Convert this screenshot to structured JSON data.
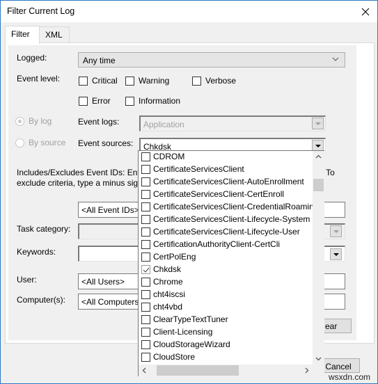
{
  "window": {
    "title": "Filter Current Log",
    "close_icon": "close-icon"
  },
  "tabs": [
    {
      "label": "Filter",
      "active": true
    },
    {
      "label": "XML",
      "active": false
    }
  ],
  "filter": {
    "logged": {
      "label": "Logged:",
      "value": "Any time"
    },
    "event_level": {
      "label": "Event level:",
      "options": [
        {
          "label": "Critical",
          "checked": false
        },
        {
          "label": "Warning",
          "checked": false
        },
        {
          "label": "Verbose",
          "checked": false
        },
        {
          "label": "Error",
          "checked": false
        },
        {
          "label": "Information",
          "checked": false
        }
      ]
    },
    "by_log": {
      "label": "By log",
      "selected": true,
      "enabled": false
    },
    "by_source": {
      "label": "By source",
      "selected": false,
      "enabled": false
    },
    "event_logs": {
      "label": "Event logs:",
      "value": "Application",
      "enabled": false
    },
    "event_sources": {
      "label": "Event sources:",
      "value": "Chkdsk"
    },
    "event_ids_text_line1": "Includes/Excludes Event IDs: Ente",
    "event_ids_text_line1_tail": "as. To",
    "event_ids_text_line2": "exclude criteria, type a minus sign",
    "event_ids": {
      "value": "<All Event IDs>"
    },
    "task_category": {
      "label": "Task category:",
      "value": ""
    },
    "keywords": {
      "label": "Keywords:",
      "value": ""
    },
    "user": {
      "label": "User:",
      "value": "<All Users>"
    },
    "computers": {
      "label": "Computer(s):",
      "value": "<All Computers"
    },
    "clear_button": "ear"
  },
  "sources_dropdown": {
    "items": [
      {
        "label": "CDROM",
        "checked": false
      },
      {
        "label": "CertificateServicesClient",
        "checked": false
      },
      {
        "label": "CertificateServicesClient-AutoEnrollment",
        "checked": false
      },
      {
        "label": "CertificateServicesClient-CertEnroll",
        "checked": false
      },
      {
        "label": "CertificateServicesClient-CredentialRoamin",
        "checked": false
      },
      {
        "label": "CertificateServicesClient-Lifecycle-System",
        "checked": false
      },
      {
        "label": "CertificateServicesClient-Lifecycle-User",
        "checked": false
      },
      {
        "label": "CertificationAuthorityClient-CertCli",
        "checked": false
      },
      {
        "label": "CertPolEng",
        "checked": false
      },
      {
        "label": "Chkdsk",
        "checked": true
      },
      {
        "label": "Chrome",
        "checked": false
      },
      {
        "label": "cht4iscsi",
        "checked": false
      },
      {
        "label": "cht4vbd",
        "checked": false
      },
      {
        "label": "ClearTypeTextTuner",
        "checked": false
      },
      {
        "label": "Client-Licensing",
        "checked": false
      },
      {
        "label": "CloudStorageWizard",
        "checked": false
      },
      {
        "label": "CloudStore",
        "checked": false
      }
    ]
  },
  "footer": {
    "cancel_label": "Cancel"
  },
  "watermark": "wsxdn.com"
}
